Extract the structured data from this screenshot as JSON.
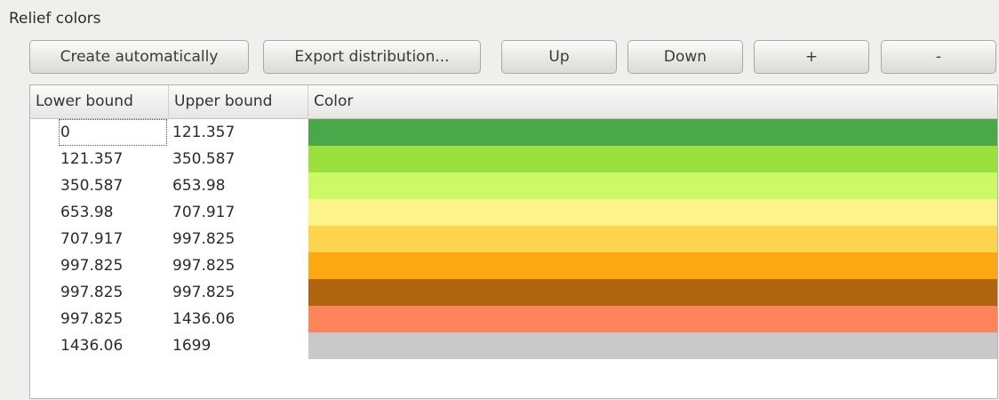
{
  "group_title": "Relief colors",
  "buttons": {
    "create": "Create automatically",
    "export": "Export distribution...",
    "up": "Up",
    "down": "Down",
    "add": "+",
    "remove": "-"
  },
  "table": {
    "headers": {
      "lower": "Lower bound",
      "upper": "Upper bound",
      "color": "Color"
    },
    "rows": [
      {
        "lower": "0",
        "upper": "121.357",
        "color": "#4aa84a"
      },
      {
        "lower": "121.357",
        "upper": "350.587",
        "color": "#9be03d"
      },
      {
        "lower": "350.587",
        "upper": "653.98",
        "color": "#ccfa66"
      },
      {
        "lower": "653.98",
        "upper": "707.917",
        "color": "#fcf38b"
      },
      {
        "lower": "707.917",
        "upper": "997.825",
        "color": "#fed34d"
      },
      {
        "lower": "997.825",
        "upper": "997.825",
        "color": "#fca812"
      },
      {
        "lower": "997.825",
        "upper": "997.825",
        "color": "#b0640e"
      },
      {
        "lower": "997.825",
        "upper": "1436.06",
        "color": "#fd835b"
      },
      {
        "lower": "1436.06",
        "upper": "1699",
        "color": "#c9c9c9"
      }
    ]
  }
}
